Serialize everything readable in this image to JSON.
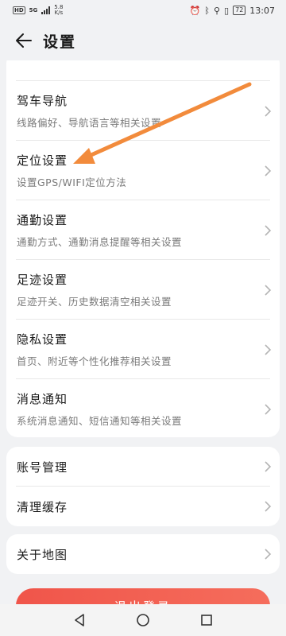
{
  "status_bar": {
    "hd": "HD",
    "signal": "5G",
    "speed_value": "5.8",
    "speed_unit": "K/s",
    "battery": "72",
    "time": "13:07"
  },
  "header": {
    "title": "设置",
    "back_icon": "arrow-left-icon"
  },
  "groups": [
    {
      "items": [
        {
          "title": "驾车导航",
          "subtitle": "线路偏好、导航语言等相关设置"
        },
        {
          "title": "定位设置",
          "subtitle": "设置GPS/WIFI定位方法"
        },
        {
          "title": "通勤设置",
          "subtitle": "通勤方式、通勤消息提醒等相关设置"
        },
        {
          "title": "足迹设置",
          "subtitle": "足迹开关、历史数据清空相关设置"
        },
        {
          "title": "隐私设置",
          "subtitle": "首页、附近等个性化推荐相关设置"
        },
        {
          "title": "消息通知",
          "subtitle": "系统消息通知、短信通知等相关设置"
        }
      ]
    },
    {
      "items": [
        {
          "title": "账号管理"
        },
        {
          "title": "清理缓存"
        }
      ]
    },
    {
      "items": [
        {
          "title": "关于地图"
        }
      ]
    }
  ],
  "logout_label": "退出登录",
  "annotation": {
    "color": "#f28b3c"
  },
  "colors": {
    "accent": "#f0554a",
    "background": "#f1f2f4"
  }
}
